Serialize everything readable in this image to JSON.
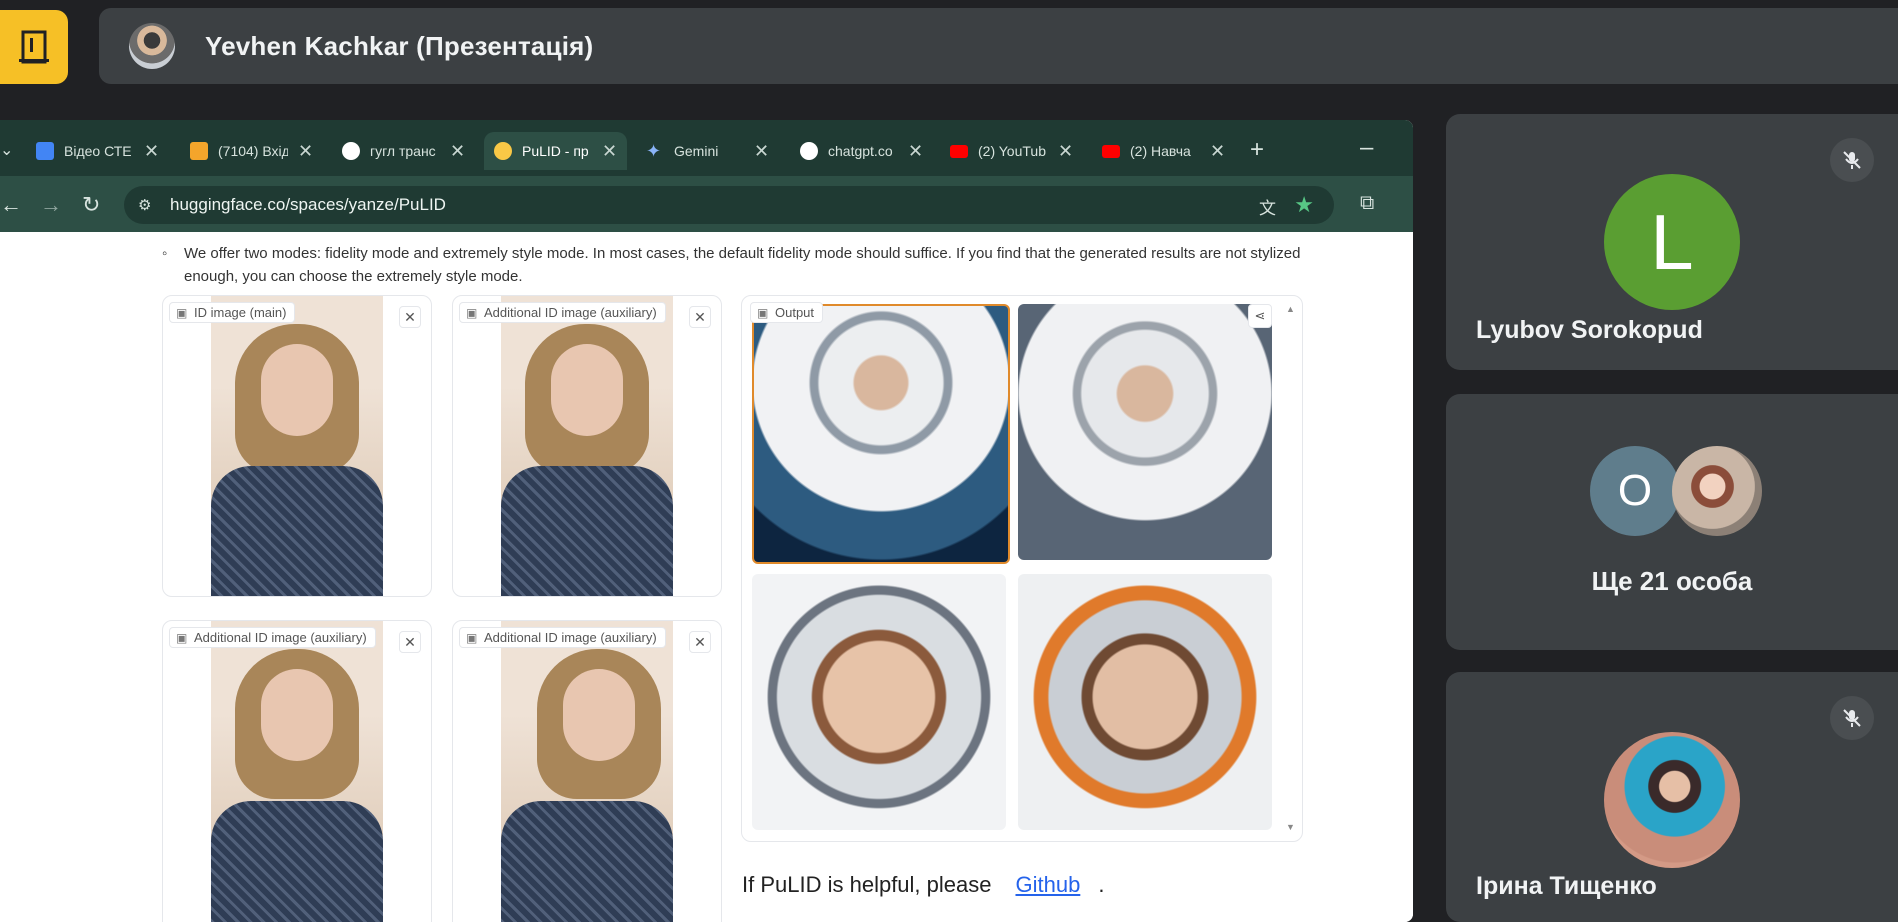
{
  "meet": {
    "presenter_name": "Yevhen Kachkar (Презентація)"
  },
  "browser": {
    "tabs": [
      {
        "title": "Відео СТЕ",
        "favicon_color": "#4285f4",
        "active": false
      },
      {
        "title": "(7104) Вхід",
        "favicon_color": "#f4a52b",
        "active": false
      },
      {
        "title": "гугл транс",
        "favicon_color": "#ffffff",
        "active": false
      },
      {
        "title": "PuLID - пр",
        "favicon_color": "#f9c846",
        "active": true
      },
      {
        "title": "Gemini",
        "favicon_color": "#8ab4f8",
        "active": false
      },
      {
        "title": "chatgpt.co",
        "favicon_color": "#ffffff",
        "active": false
      },
      {
        "title": "(2) YouTub",
        "favicon_color": "#ff0000",
        "active": false
      },
      {
        "title": "(2) Навча",
        "favicon_color": "#ff0000",
        "active": false
      }
    ],
    "tab_close_glyph": "✕",
    "new_tab_glyph": "+",
    "url": "huggingface.co/spaces/yanze/PuLID"
  },
  "page": {
    "bullet_text": "We offer two modes: fidelity mode and extremely style mode. In most cases, the default fidelity mode should suffice. If you find that the generated results are not stylized enough, you can choose the extremely style mode.",
    "panels": {
      "main_label": "ID image (main)",
      "aux1_label": "Additional ID image (auxiliary)",
      "aux2_label": "Additional ID image (auxiliary)",
      "aux3_label": "Additional ID image (auxiliary)"
    },
    "output_label": "Output",
    "footer_text": "If PuLID is helpful, please",
    "footer_link": "Github",
    "footer_tail": "."
  },
  "participants": [
    {
      "name": "Lyubov Sorokopud",
      "initial": "L",
      "avatar_color": "#5a9e32",
      "muted": true
    },
    {
      "others_text": "Ще 21 особа",
      "initial": "O",
      "avatar_color": "#5f7d8c"
    },
    {
      "name": "Ірина Тищенко",
      "muted": true
    }
  ]
}
